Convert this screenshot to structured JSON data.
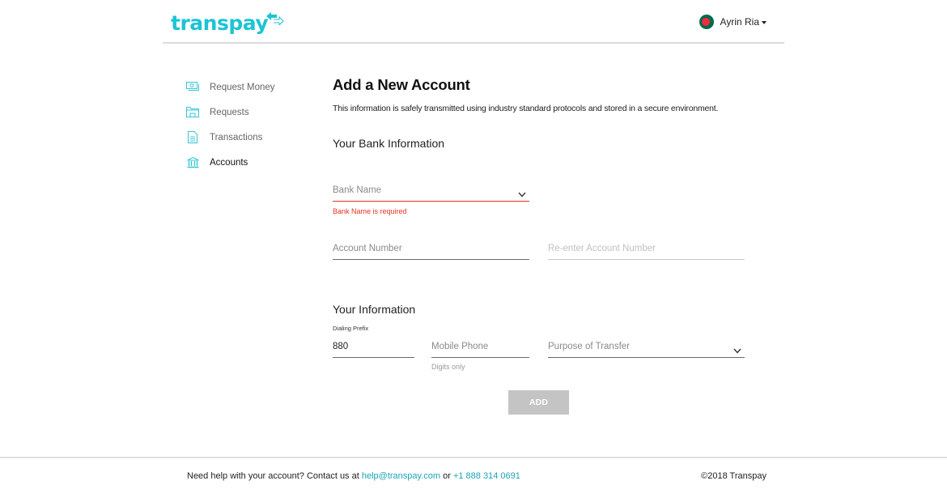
{
  "header": {
    "logo_text": "transpay",
    "user_name": "Ayrin Ria",
    "brand_color": "#1cc4d4"
  },
  "sidebar": {
    "items": [
      {
        "label": "Request Money",
        "icon": "money-icon",
        "active": false
      },
      {
        "label": "Requests",
        "icon": "folder-icon",
        "active": false
      },
      {
        "label": "Transactions",
        "icon": "document-icon",
        "active": false
      },
      {
        "label": "Accounts",
        "icon": "bank-icon",
        "active": true
      }
    ]
  },
  "main": {
    "title": "Add a New Account",
    "subtitle": "This information is safely transmitted using industry standard protocols and stored in a secure environment.",
    "bank_section": {
      "heading": "Your Bank Information",
      "bank_name": {
        "placeholder": "Bank Name",
        "error": "Bank Name is required"
      },
      "account_number": {
        "placeholder": "Account Number"
      },
      "reenter_account_number": {
        "placeholder": "Re-enter Account Number"
      }
    },
    "info_section": {
      "heading": "Your Information",
      "dialing_prefix": {
        "label": "Dialing Prefix",
        "value": "880"
      },
      "mobile_phone": {
        "placeholder": "Mobile Phone",
        "hint": "Digits only"
      },
      "purpose_of_transfer": {
        "placeholder": "Purpose of Transfer"
      }
    },
    "add_button": "ADD"
  },
  "footer": {
    "help_text": "Need help with your account? Contact us at ",
    "email": "help@transpay.com",
    "or": " or ",
    "phone": "+1 888 314 0691",
    "copyright": "©2018 Transpay"
  }
}
